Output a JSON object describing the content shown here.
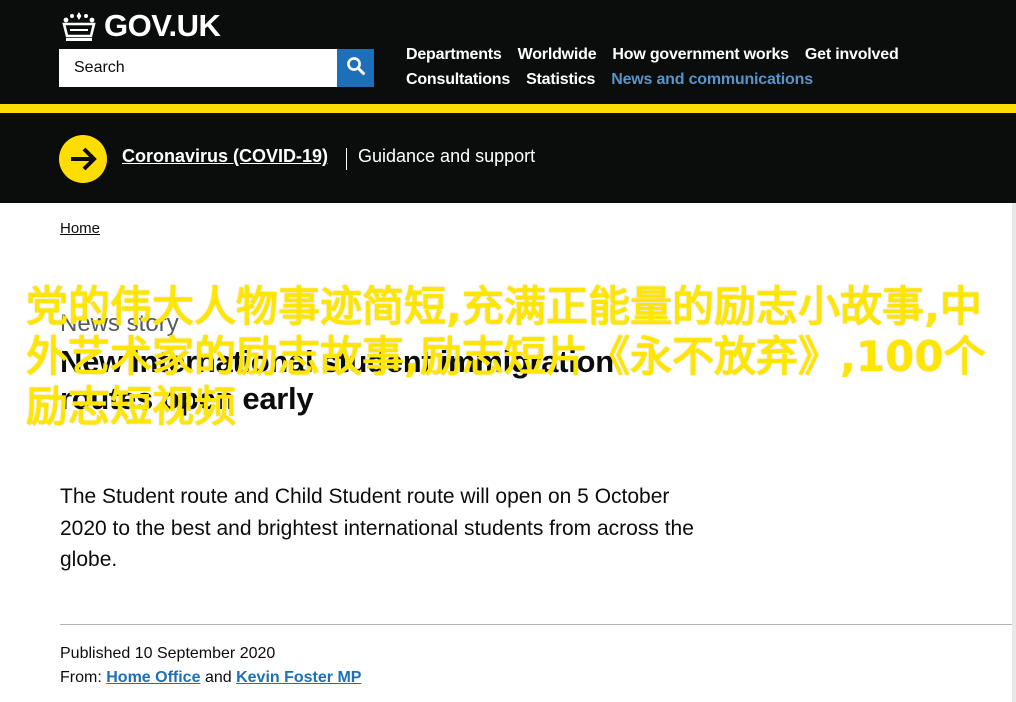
{
  "header": {
    "logo_text": "GOV.UK",
    "search": {
      "placeholder": "Search"
    },
    "nav": [
      {
        "label": "Departments",
        "active": false
      },
      {
        "label": "Worldwide",
        "active": false
      },
      {
        "label": "How government works",
        "active": false
      },
      {
        "label": "Get involved",
        "active": false
      },
      {
        "label": "Consultations",
        "active": false
      },
      {
        "label": "Statistics",
        "active": false
      },
      {
        "label": "News and communications",
        "active": true
      }
    ]
  },
  "banner": {
    "link": "Coronavirus (COVID-19)",
    "guidance": "Guidance and support"
  },
  "breadcrumb": {
    "home": "Home"
  },
  "article": {
    "caption": "News story",
    "title": "New international student immigration routes open early",
    "lead": "The Student route and Child Student route will open on 5 October 2020 to the best and brightest international students from across the globe.",
    "published_label": "Published",
    "published_date": "10 September 2020",
    "from_label": "From:",
    "from_org_1": "Home Office",
    "and_text": "and",
    "from_org_2": "Kevin Foster MP"
  },
  "overlay": {
    "text": "党的伟大人物事迹简短,充满正能量的励志小故事,中外艺术家的励志故事,励志短片《永不放弃》,100个励志短视频"
  },
  "colors": {
    "header_bg": "#0b0c0c",
    "stripe": "#ffdd00",
    "link": "#1d70b8",
    "nav_active": "#5694ca",
    "overlay_text": "#ffe600"
  },
  "icons": {
    "logo": "crown-icon",
    "search": "search-icon",
    "banner": "arrow-right-circle-icon"
  }
}
